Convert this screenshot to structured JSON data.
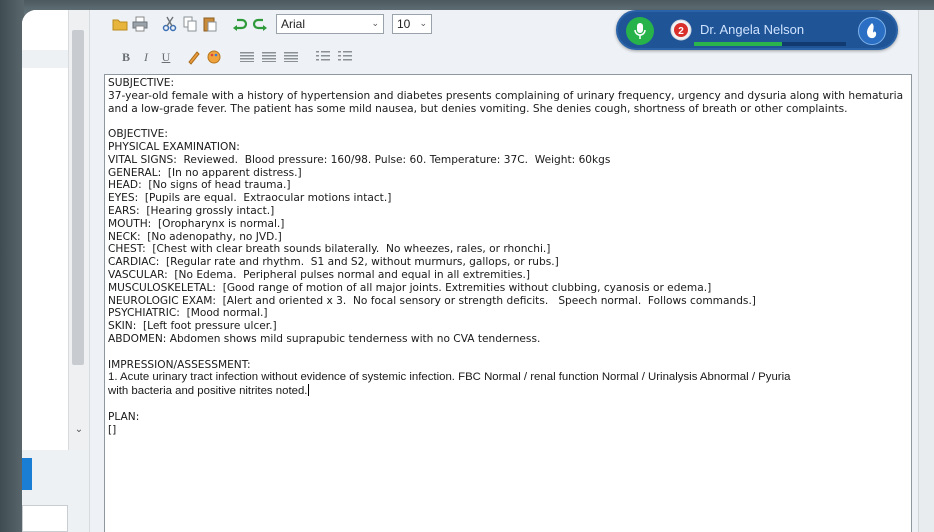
{
  "toolbar": {
    "font_family": "Arial",
    "font_size": "10",
    "bold_label": "B",
    "italic_label": "I",
    "underline_label": "U"
  },
  "dictation": {
    "user_name": "Dr. Angela Nelson",
    "notification_count": "2",
    "level_fraction": 0.58
  },
  "document": {
    "subjective_heading": "SUBJECTIVE:",
    "subjective_text": "37-year-old female with a history of hypertension and diabetes presents complaining of urinary frequency, urgency and dysuria along with hematuria and a low-grade fever.  The patient has some mild nausea, but denies vomiting.  She denies cough, shortness of breath or other complaints.",
    "objective_heading": "OBJECTIVE:",
    "exam_heading": "PHYSICAL EXAMINATION:",
    "exam_lines": [
      "VITAL SIGNS:  Reviewed.  Blood pressure: 160/98. Pulse: 60. Temperature: 37C.  Weight: 60kgs",
      "GENERAL:  [In no apparent distress.]",
      "HEAD:  [No signs of head trauma.]",
      "EYES:  [Pupils are equal.  Extraocular motions intact.]",
      "EARS:  [Hearing grossly intact.]",
      "MOUTH:  [Oropharynx is normal.]",
      "NECK:  [No adenopathy, no JVD.]",
      "CHEST:  [Chest with clear breath sounds bilaterally.  No wheezes, rales, or rhonchi.]",
      "CARDIAC:  [Regular rate and rhythm.  S1 and S2, without murmurs, gallops, or rubs.]",
      "VASCULAR:  [No Edema.  Peripheral pulses normal and equal in all extremities.]",
      "MUSCULOSKELETAL:  [Good range of motion of all major joints. Extremities without clubbing, cyanosis or edema.]",
      "NEUROLOGIC EXAM:  [Alert and oriented x 3.  No focal sensory or strength deficits.   Speech normal.  Follows commands.]",
      "PSYCHIATRIC:  [Mood normal.]",
      "SKIN:  [Left foot pressure ulcer.]",
      "ABDOMEN: Abdomen shows mild suprapubic tenderness with no CVA tenderness."
    ],
    "impression_heading": "IMPRESSION/ASSESSMENT:",
    "impression_line1": "1. Acute urinary tract infection without evidence of systemic infection. FBC Normal / renal function Normal / Urinalysis Abnormal / Pyuria",
    "impression_line2": "with bacteria and positive nitrites noted.",
    "plan_heading": "PLAN:",
    "plan_field": "[]"
  }
}
